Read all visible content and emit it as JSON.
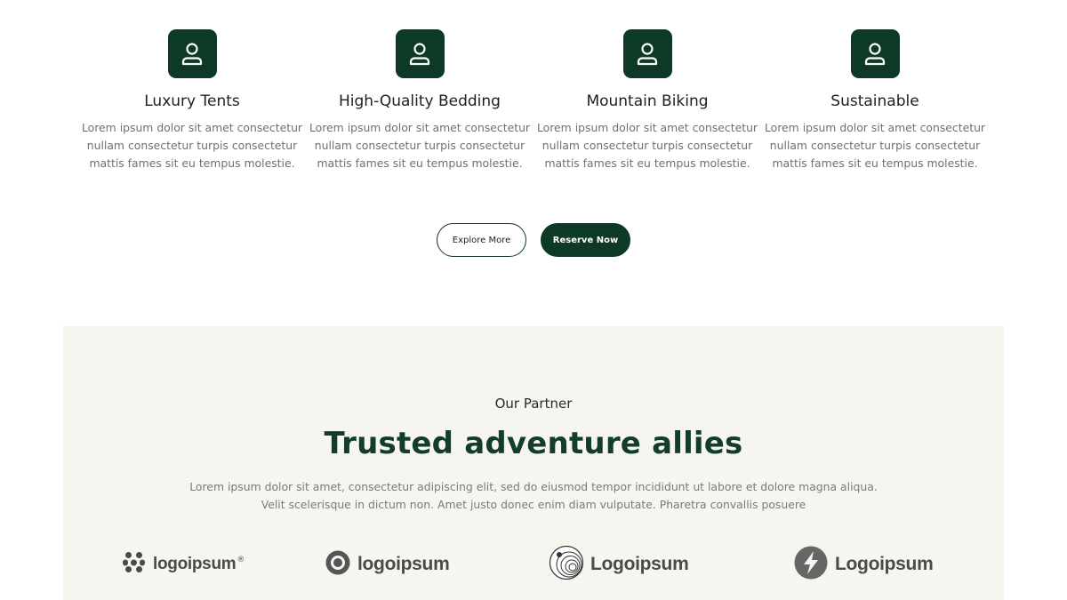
{
  "features": [
    {
      "title": "Luxury Tents",
      "description": "Lorem ipsum dolor sit amet consectetur nullam consectetur turpis consectetur mattis fames sit eu tempus molestie.",
      "icon": "user-icon"
    },
    {
      "title": "High-Quality Bedding",
      "description": "Lorem ipsum dolor sit amet consectetur nullam consectetur turpis consectetur mattis fames sit eu tempus molestie.",
      "icon": "user-icon"
    },
    {
      "title": "Mountain Biking",
      "description": "Lorem ipsum dolor sit amet consectetur nullam consectetur turpis consectetur mattis fames sit eu tempus molestie.",
      "icon": "user-icon"
    },
    {
      "title": "Sustainable",
      "description": "Lorem ipsum dolor sit amet consectetur nullam consectetur turpis consectetur mattis fames sit eu tempus molestie.",
      "icon": "user-icon"
    }
  ],
  "cta": {
    "explore_label": "Explore More",
    "reserve_label": "Reserve Now"
  },
  "partners": {
    "eyebrow": "Our Partner",
    "title": "Trusted adventure allies",
    "description_line1": "Lorem ipsum dolor sit amet, consectetur adipiscing elit, sed do eiusmod tempor incididunt ut labore et dolore magna aliqua.",
    "description_line2": "Velit scelerisque in dictum non. Amet justo donec enim diam vulputate. Pharetra convallis posuere",
    "logos": [
      {
        "text": "logoipsum",
        "mark": "®",
        "icon": "molecule-logo-icon"
      },
      {
        "text": "logoipsum",
        "icon": "ring-logo-icon"
      },
      {
        "text": "Logoipsum",
        "icon": "sphere-logo-icon"
      },
      {
        "text": "Logoipsum",
        "icon": "bolt-logo-icon"
      }
    ]
  },
  "colors": {
    "brand_green": "#0c3a26",
    "title_green": "#113d29",
    "partner_bg": "#f7f5ef"
  }
}
